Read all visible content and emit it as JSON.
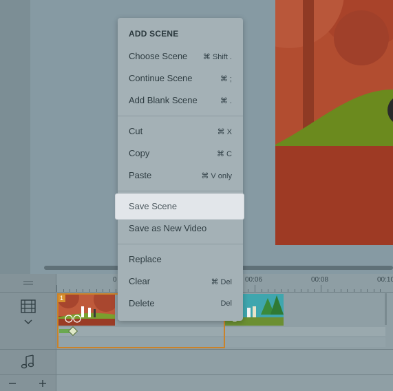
{
  "timeline": {
    "time_labels": [
      "0",
      "00:06",
      "00:08",
      "00:10"
    ],
    "clip_number": "1"
  },
  "menu": {
    "header": "ADD SCENE",
    "items": [
      {
        "label": "Choose Scene",
        "shortcut": "⌘ Shift ."
      },
      {
        "label": "Continue Scene",
        "shortcut": "⌘ ;"
      },
      {
        "label": "Add Blank Scene",
        "shortcut": "⌘ ."
      },
      {
        "label": "Cut",
        "shortcut": "⌘ X"
      },
      {
        "label": "Copy",
        "shortcut": "⌘ C"
      },
      {
        "label": "Paste",
        "shortcut": "⌘ V only"
      },
      {
        "label": "Save Scene",
        "shortcut": ""
      },
      {
        "label": "Save as New Video",
        "shortcut": ""
      },
      {
        "label": "Replace",
        "shortcut": ""
      },
      {
        "label": "Clear",
        "shortcut": "⌘ Del"
      },
      {
        "label": "Delete",
        "shortcut": "Del"
      }
    ],
    "highlighted": "Save Scene"
  },
  "icons": {
    "scenes": "film-strip-icon",
    "expand": "chevron-down-icon",
    "audio": "music-note-icon",
    "zoom_out": "minus-icon",
    "zoom_in": "plus-icon",
    "drag": "drag-handle-icon"
  },
  "colors": {
    "highlight": "#e2e6ea",
    "clip_border": "#c9822a",
    "scene_red": "#b04a2e",
    "scene_green": "#6b8a1e"
  }
}
